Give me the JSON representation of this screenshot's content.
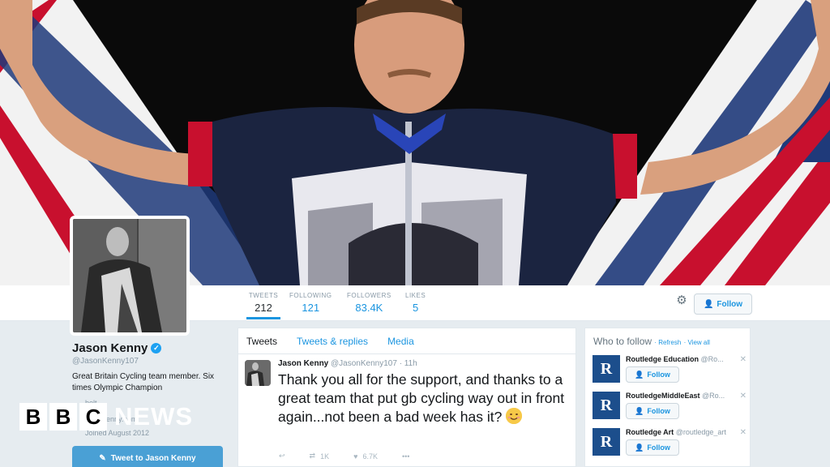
{
  "profile": {
    "name": "Jason Kenny",
    "handle": "@JasonKenny107",
    "bio": "Great Britain Cycling team member. Six times Olympic Champion",
    "location": "bolt",
    "website": "jasonkenny.com",
    "joined": "Joined August 2012",
    "tweet_to_label": "Tweet to Jason Kenny"
  },
  "stats": [
    {
      "label": "TWEETS",
      "value": "212"
    },
    {
      "label": "FOLLOWING",
      "value": "121"
    },
    {
      "label": "FOLLOWERS",
      "value": "83.4K"
    },
    {
      "label": "LIKES",
      "value": "5"
    }
  ],
  "header": {
    "follow_label": "Follow"
  },
  "timeline": {
    "tabs": [
      "Tweets",
      "Tweets & replies",
      "Media"
    ],
    "tweet": {
      "name": "Jason Kenny",
      "handle": "@JasonKenny107",
      "time": "· 11h",
      "text": "Thank you all for the support, and thanks to a great team that put gb cycling way out in front again...not been a bad week has it? ",
      "retweets": "1K",
      "likes": "6.7K"
    }
  },
  "who_to_follow": {
    "title": "Who to follow",
    "refresh": "Refresh",
    "view_all": "View all",
    "items": [
      {
        "name": "Routledge Education",
        "handle": "@Ro...",
        "follow": "Follow"
      },
      {
        "name": "RoutledgeMiddleEast",
        "handle": "@Ro...",
        "follow": "Follow"
      },
      {
        "name": "Routledge Art",
        "handle": "@routledge_art",
        "follow": "Follow"
      }
    ]
  },
  "watermark": {
    "letters": [
      "B",
      "B",
      "C"
    ],
    "news": "NEWS"
  },
  "colors": {
    "accent": "#1b95e0",
    "tweet_button": "#4aa0d5",
    "routledge_blue": "#1c4e8c"
  }
}
